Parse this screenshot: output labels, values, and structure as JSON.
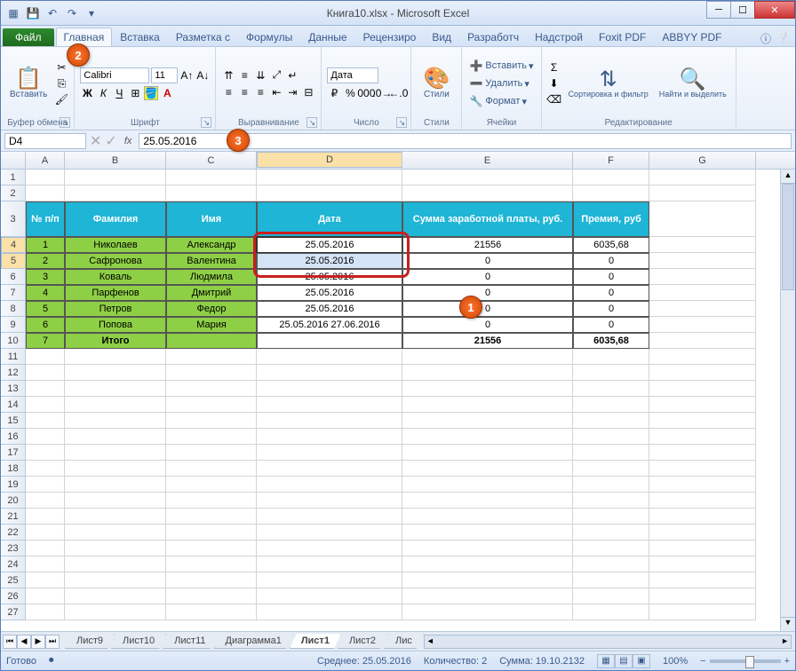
{
  "title": {
    "doc": "Книга10.xlsx",
    "sep": " - ",
    "app": "Microsoft Excel"
  },
  "tabs": {
    "file": "Файл",
    "items": [
      "Главная",
      "Вставка",
      "Разметка с",
      "Формулы",
      "Данные",
      "Рецензиро",
      "Вид",
      "Разработч",
      "Надстрой",
      "Foxit PDF",
      "ABBYY PDF"
    ],
    "active": 0
  },
  "ribbon": {
    "clipboard": {
      "label": "Буфер обмена",
      "paste": "Вставить"
    },
    "font": {
      "label": "Шрифт",
      "name": "Calibri",
      "size": "11"
    },
    "alignment": {
      "label": "Выравнивание"
    },
    "number": {
      "label": "Число",
      "format": "Дата"
    },
    "styles": {
      "label": "Стили",
      "btn": "Стили"
    },
    "cells": {
      "label": "Ячейки",
      "insert": "Вставить",
      "delete": "Удалить",
      "format": "Формат"
    },
    "editing": {
      "label": "Редактирование",
      "sort": "Сортировка и фильтр",
      "find": "Найти и выделить"
    }
  },
  "formula": {
    "cell": "D4",
    "value": "25.05.2016"
  },
  "columns": [
    "A",
    "B",
    "C",
    "D",
    "E",
    "F",
    "G"
  ],
  "table": {
    "headers": [
      "№ п/п",
      "Фамилия",
      "Имя",
      "Дата",
      "Сумма заработной платы, руб.",
      "Премия, руб"
    ],
    "rows": [
      {
        "n": "1",
        "fam": "Николаев",
        "im": "Александр",
        "d": "25.05.2016",
        "sum": "21556",
        "prem": "6035,68"
      },
      {
        "n": "2",
        "fam": "Сафронова",
        "im": "Валентина",
        "d": "25.05.2016",
        "sum": "0",
        "prem": "0"
      },
      {
        "n": "3",
        "fam": "Коваль",
        "im": "Людмила",
        "d": "25.05.2016",
        "sum": "0",
        "prem": "0"
      },
      {
        "n": "4",
        "fam": "Парфенов",
        "im": "Дмитрий",
        "d": "25.05.2016",
        "sum": "0",
        "prem": "0"
      },
      {
        "n": "5",
        "fam": "Петров",
        "im": "Федор",
        "d": "25.05.2016",
        "sum": "0",
        "prem": "0"
      },
      {
        "n": "6",
        "fam": "Попова",
        "im": "Мария",
        "d": "25.05.2016 27.06.2016",
        "sum": "0",
        "prem": "0"
      }
    ],
    "total": {
      "label": "Итого",
      "n": "7",
      "sum": "21556",
      "prem": "6035,68"
    }
  },
  "sheets": {
    "items": [
      "Лист9",
      "Лист10",
      "Лист11",
      "Диаграмма1",
      "Лист1",
      "Лист2",
      "Лис"
    ],
    "active": 4
  },
  "status": {
    "ready": "Готово",
    "avg_label": "Среднее:",
    "avg": "25.05.2016",
    "count_label": "Количество:",
    "count": "2",
    "sum_label": "Сумма:",
    "sum": "19.10.2132",
    "zoom": "100%"
  },
  "callouts": {
    "c1": "1",
    "c2": "2",
    "c3": "3"
  }
}
